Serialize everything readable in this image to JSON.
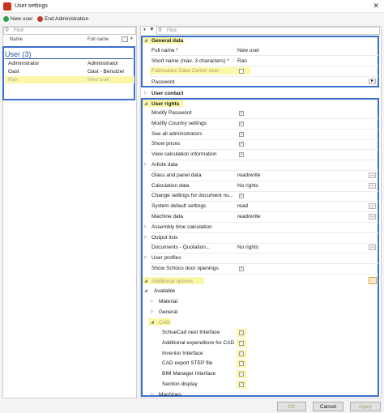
{
  "window": {
    "title": "User settings",
    "close_glyph": "✕"
  },
  "toolbar": {
    "new_user": "New user",
    "end_admin": "End Administration"
  },
  "left": {
    "find_placeholder": "Find",
    "col_name": "Name",
    "col_fullname": "Full name",
    "group_label": "User (3)",
    "users": [
      {
        "name": "Administrator",
        "full": "Administrator",
        "highlight": false
      },
      {
        "name": "Gast",
        "full": "Gast - Benutzer",
        "highlight": false
      },
      {
        "name": "Ran",
        "full": "New user",
        "highlight": true
      }
    ]
  },
  "right": {
    "find_placeholder": "Find",
    "general": {
      "header": "General data",
      "rows": [
        {
          "label": "Full name *",
          "value": "New user"
        },
        {
          "label": "Short name (max. 3 characters) *",
          "value": "Ran"
        },
        {
          "label": "Fabrication Data Center user",
          "value": ""
        },
        {
          "label": "Password",
          "value": ""
        }
      ]
    },
    "contact": {
      "header": "User contact"
    },
    "rights": {
      "header": "User rights",
      "rows": [
        {
          "label": "Modify Password",
          "kind": "check",
          "value": ""
        },
        {
          "label": "Modify Country settings",
          "kind": "check",
          "value": ""
        },
        {
          "label": "See all administrators",
          "kind": "check",
          "value": ""
        },
        {
          "label": "Show prices",
          "kind": "check",
          "value": ""
        },
        {
          "label": "View calculation information",
          "kind": "check",
          "value": ""
        },
        {
          "label": "Article data",
          "kind": "group",
          "value": ""
        },
        {
          "label": "Glass and panel data",
          "kind": "value",
          "value": "read/write"
        },
        {
          "label": "Calculation data",
          "kind": "value",
          "value": "No rights"
        },
        {
          "label": "Change settings for document nu...",
          "kind": "check",
          "value": ""
        },
        {
          "label": "System default settings",
          "kind": "value",
          "value": "read"
        },
        {
          "label": "Machine data",
          "kind": "value",
          "value": "read/write"
        },
        {
          "label": "Assembly time calculation",
          "kind": "group",
          "value": ""
        },
        {
          "label": "Output lists",
          "kind": "group",
          "value": ""
        },
        {
          "label": "Documents - Quotation...",
          "kind": "value",
          "value": "No rights"
        },
        {
          "label": "User profiles",
          "kind": "group",
          "value": ""
        },
        {
          "label": "Show Schüco door openings",
          "kind": "check",
          "value": ""
        }
      ]
    },
    "additional": {
      "header": "Additional options",
      "available": "Available",
      "material": "Material",
      "general": "General",
      "cad": "CAD",
      "cad_items": [
        "SchueCad next Interface",
        "Additional expenditure for CAD",
        "Inventor Interface",
        "CAD export STEP file",
        "BIM Manager Interface",
        "Section display"
      ],
      "machines": "Machines"
    }
  },
  "buttons": {
    "ok": "OK",
    "cancel": "Cancel",
    "apply": "Apply"
  },
  "colors": {
    "highlight": "#fbf7a9",
    "frame": "#3b6fce",
    "brand": "#c8321e"
  }
}
